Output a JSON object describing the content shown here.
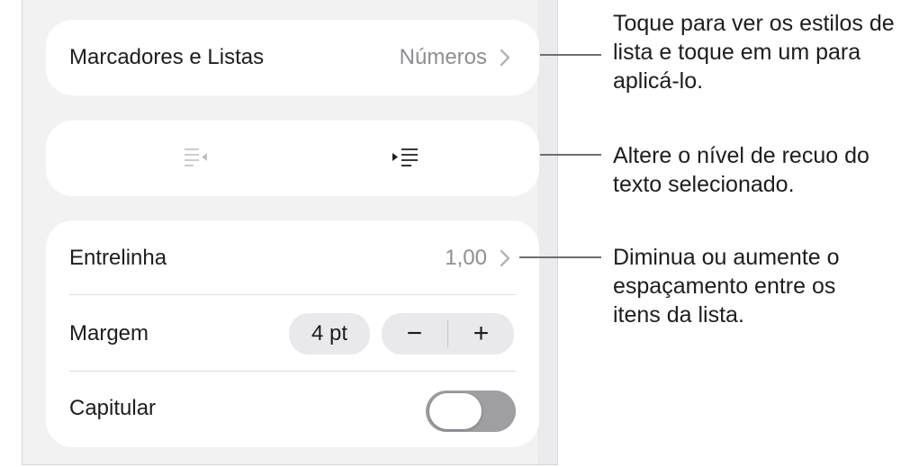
{
  "inspector": {
    "bullets_lists": {
      "label": "Marcadores e Listas",
      "value": "Números"
    },
    "indentation": {
      "decrease": {
        "icon": "decrease-indent-icon"
      },
      "increase": {
        "icon": "increase-indent-icon"
      }
    },
    "line_spacing": {
      "label": "Entrelinha",
      "value": "1,00"
    },
    "margin": {
      "label": "Margem",
      "value": "4 pt",
      "decrement": "−",
      "increment": "+"
    },
    "drop_cap": {
      "label": "Capitular",
      "enabled": false
    }
  },
  "callouts": [
    {
      "text": "Toque para ver os estilos de lista e toque em um para aplicá-lo."
    },
    {
      "text": "Altere o nível de recuo do texto selecionado."
    },
    {
      "text": "Diminua ou aumente o espaçamento entre os itens da lista."
    }
  ],
  "colors": {
    "panel_background": "#f2f2f3",
    "card_background": "#ffffff",
    "secondary_text": "#8e8e93",
    "toggle_off": "#9e9ea3"
  }
}
